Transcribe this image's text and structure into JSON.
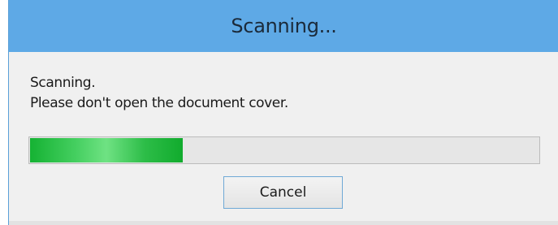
{
  "window": {
    "title": "Scanning..."
  },
  "message": {
    "line1": "Scanning.",
    "line2": "Please don't open the document cover."
  },
  "progress": {
    "fraction": 0.3
  },
  "buttons": {
    "cancel_label": "Cancel"
  },
  "colors": {
    "titlebar": "#5ea9e6",
    "progress_fill": "#2dbd48",
    "window_bg": "#f0f0f0"
  }
}
